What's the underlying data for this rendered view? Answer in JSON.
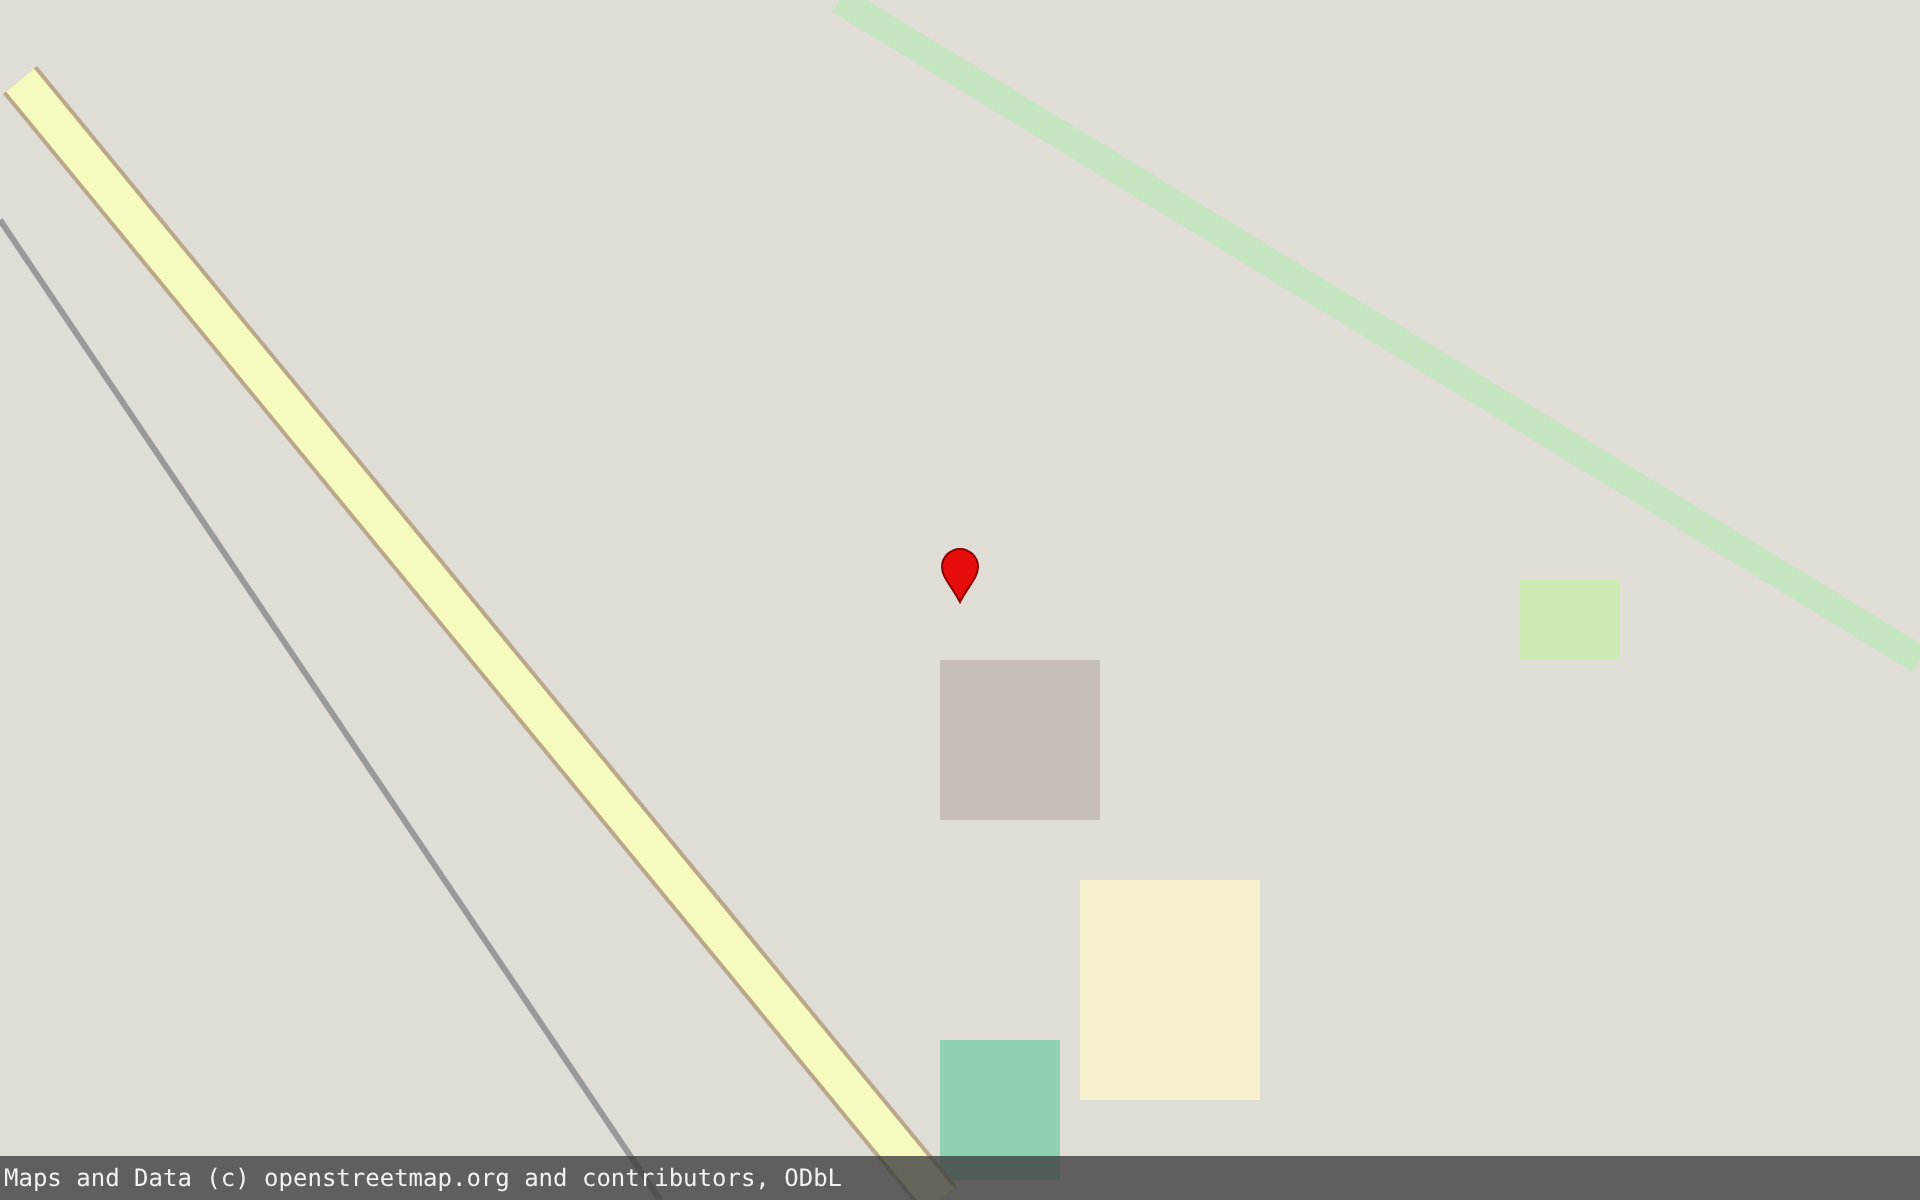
{
  "map": {
    "marker": true
  },
  "attribution": "Maps and Data (c) openstreetmap.org and contributors, ODbL"
}
